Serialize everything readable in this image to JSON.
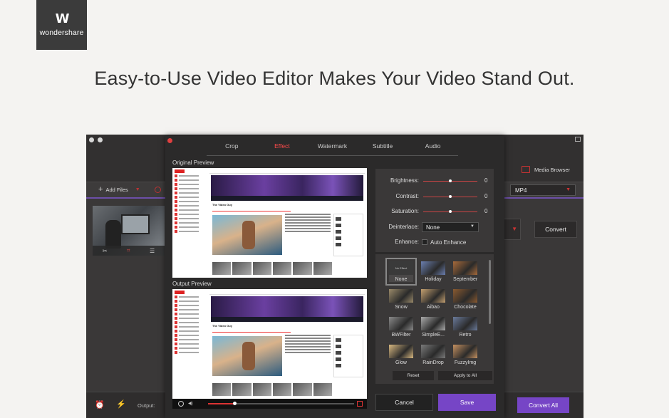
{
  "brand": {
    "name": "wondershare",
    "mark": "W"
  },
  "headline": "Easy-to-Use Video Editor Makes Your Video Stand Out.",
  "app": {
    "add_files": "Add Files",
    "media_browser": "Media Browser",
    "format": "MP4",
    "convert": "Convert",
    "output_label": "Output:",
    "convert_all": "Convert All",
    "accent_color": "#7645c6"
  },
  "dialog": {
    "tabs": [
      "Crop",
      "Effect",
      "Watermark",
      "Subtitle",
      "Audio"
    ],
    "active_tab": "Effect",
    "original_preview": "Original Preview",
    "output_preview": "Output Preview",
    "preview_page": {
      "logo": "YouTube",
      "channel_title": "The Video Guy"
    },
    "adjust": {
      "brightness": {
        "label": "Brightness:",
        "value": "0"
      },
      "contrast": {
        "label": "Contrast:",
        "value": "0"
      },
      "saturation": {
        "label": "Saturation:",
        "value": "0"
      },
      "deinterlace": {
        "label": "Deinterlace:",
        "value": "None"
      },
      "enhance": {
        "label": "Enhance:",
        "option": "Auto Enhance"
      }
    },
    "filters": [
      {
        "name": "None",
        "color": "#4a4a4a"
      },
      {
        "name": "Holiday",
        "color": "#6b7fb0"
      },
      {
        "name": "September",
        "color": "#a86a3a"
      },
      {
        "name": "Snow",
        "color": "#9a8a6a"
      },
      {
        "name": "Aibao",
        "color": "#c4a070"
      },
      {
        "name": "Chocolate",
        "color": "#8a5a30"
      },
      {
        "name": "BWFilter",
        "color": "#8a8a8a"
      },
      {
        "name": "SimpleE...",
        "color": "#aaaaaa"
      },
      {
        "name": "Retro",
        "color": "#6a7a9a"
      },
      {
        "name": "Glow",
        "color": "#d8b880"
      },
      {
        "name": "RainDrop",
        "color": "#7a7a7a"
      },
      {
        "name": "FuzzyImg",
        "color": "#c49060"
      }
    ],
    "none_tile_text": "No Effect",
    "reset": "Reset",
    "apply_all": "Apply to All",
    "cancel": "Cancel",
    "save": "Save",
    "playback_progress": 0.18
  }
}
